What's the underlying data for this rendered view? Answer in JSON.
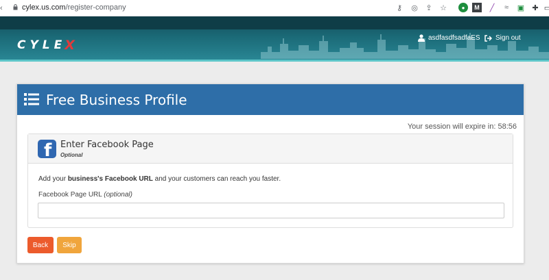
{
  "browser": {
    "url_domain": "cylex.us.com",
    "url_path": "/register-company",
    "toolbar_icons": [
      "key-icon",
      "eye-off-icon",
      "share-icon",
      "star-icon",
      "extension-green-icon",
      "gmail-m-icon",
      "pen-icon",
      "wave-icon",
      "calendar-icon",
      "puzzle-icon",
      "window-icon"
    ]
  },
  "header": {
    "logo_text": "CYLE",
    "logo_x": "X",
    "username": "asdfasdfsadfaES",
    "signout_label": "Sign out"
  },
  "card": {
    "title": "Free Business Profile",
    "session_text": "Your session will expire in: 58:56"
  },
  "panel": {
    "title": "Enter Facebook Page",
    "subtitle": "Optional",
    "desc_pre": "Add your ",
    "desc_bold": "business's Facebook URL",
    "desc_post": " and your customers can reach you faster.",
    "field_label": "Facebook Page URL ",
    "field_label_optional": "(optional)",
    "input_value": "",
    "input_placeholder": ""
  },
  "buttons": {
    "back_label": "Back",
    "skip_label": "Skip"
  },
  "colors": {
    "card_header": "#2e6ea8",
    "back_button": "#ec5b2c",
    "skip_button": "#f0a53c",
    "facebook": "#2f67b1"
  }
}
